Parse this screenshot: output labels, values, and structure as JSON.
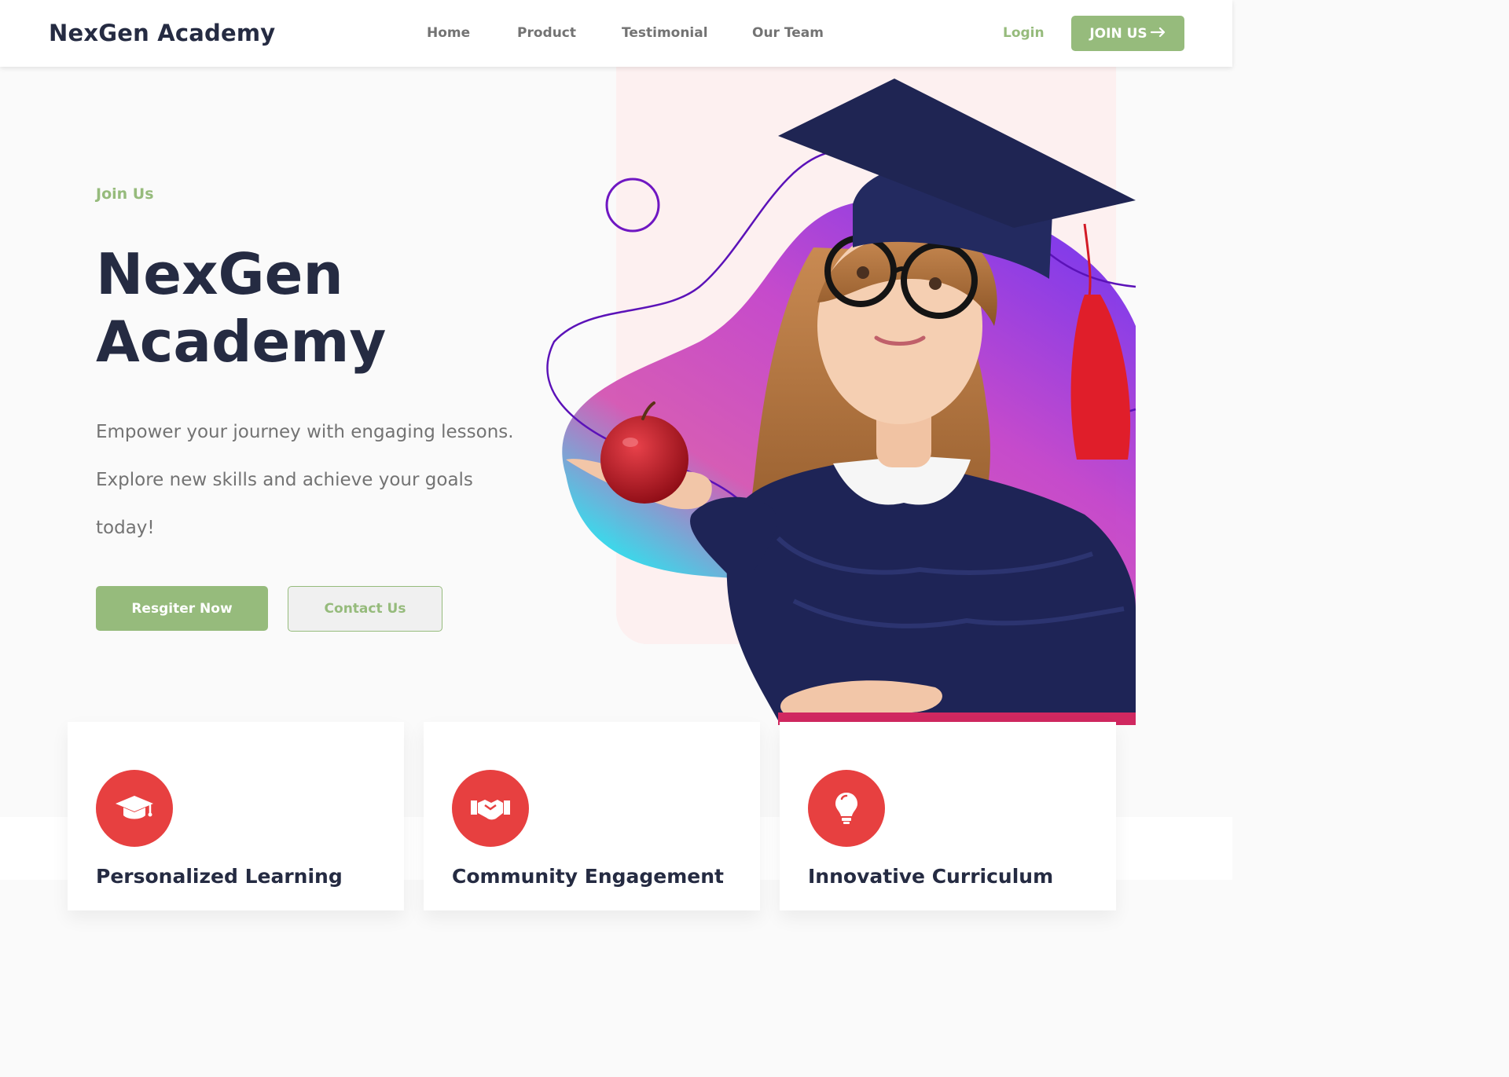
{
  "header": {
    "brand": "NexGen Academy",
    "nav": [
      {
        "label": "Home"
      },
      {
        "label": "Product"
      },
      {
        "label": "Testimonial"
      },
      {
        "label": "Our Team"
      }
    ],
    "login_label": "Login",
    "join_label": "JOIN US",
    "join_icon": "arrow-right-icon"
  },
  "hero": {
    "tag": "Join Us",
    "title_line1": "NexGen",
    "title_line2": "Academy",
    "description": "Empower your journey with engaging lessons. Explore new skills and achieve your goals today!",
    "register_label": "Resgiter Now",
    "contact_label": "Contact Us",
    "image_subject": "girl in graduation cap holding a red apple"
  },
  "features": [
    {
      "title": "Personalized Learning",
      "icon": "graduation-cap-icon"
    },
    {
      "title": "Community Engagement",
      "icon": "handshake-icon"
    },
    {
      "title": "Innovative Curriculum",
      "icon": "lightbulb-icon"
    }
  ],
  "colors": {
    "accent": "#96bb7c",
    "dark": "#252b42",
    "muted": "#737373",
    "icon_bg": "#e74040"
  }
}
